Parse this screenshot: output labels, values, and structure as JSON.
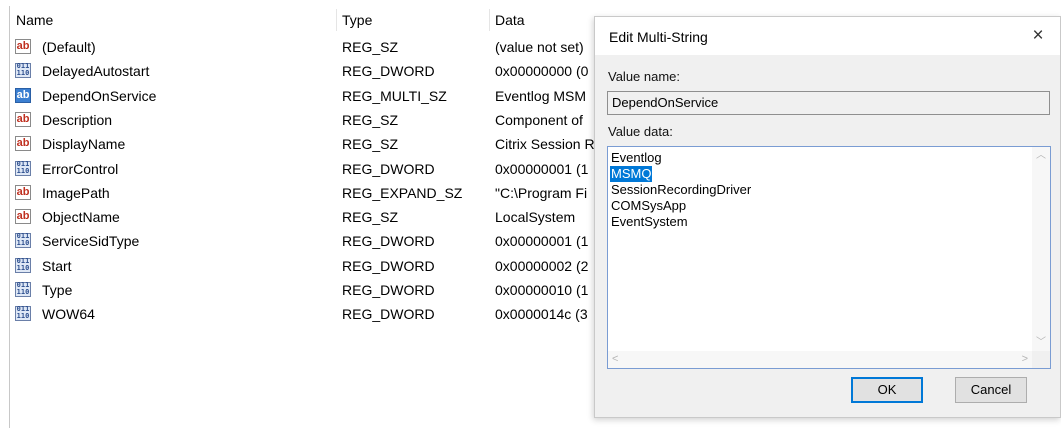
{
  "columns": {
    "name": "Name",
    "type": "Type",
    "data": "Data"
  },
  "rows": [
    {
      "icon": "string-value-icon",
      "name": "(Default)",
      "type": "REG_SZ",
      "data": "(value not set)"
    },
    {
      "icon": "binary-value-icon",
      "name": "DelayedAutostart",
      "type": "REG_DWORD",
      "data": "0x00000000 (0"
    },
    {
      "icon": "string-value-icon",
      "name": "DependOnService",
      "type": "REG_MULTI_SZ",
      "data": "Eventlog MSM"
    },
    {
      "icon": "string-value-icon",
      "name": "Description",
      "type": "REG_SZ",
      "data": "Component of"
    },
    {
      "icon": "string-value-icon",
      "name": "DisplayName",
      "type": "REG_SZ",
      "data": "Citrix Session R"
    },
    {
      "icon": "binary-value-icon",
      "name": "ErrorControl",
      "type": "REG_DWORD",
      "data": "0x00000001 (1"
    },
    {
      "icon": "string-value-icon",
      "name": "ImagePath",
      "type": "REG_EXPAND_SZ",
      "data": "\"C:\\Program Fi"
    },
    {
      "icon": "string-value-icon",
      "name": "ObjectName",
      "type": "REG_SZ",
      "data": "LocalSystem"
    },
    {
      "icon": "binary-value-icon",
      "name": "ServiceSidType",
      "type": "REG_DWORD",
      "data": "0x00000001 (1"
    },
    {
      "icon": "binary-value-icon",
      "name": "Start",
      "type": "REG_DWORD",
      "data": "0x00000002 (2"
    },
    {
      "icon": "binary-value-icon",
      "name": "Type",
      "type": "REG_DWORD",
      "data": "0x00000010 (1"
    },
    {
      "icon": "binary-value-icon",
      "name": "WOW64",
      "type": "REG_DWORD",
      "data": "0x0000014c (3"
    }
  ],
  "icons": {
    "string_glyph": "ab",
    "binary_glyph": "011 110"
  },
  "dialog": {
    "title": "Edit Multi-String",
    "close_glyph": "×",
    "value_name_label": "Value name:",
    "value_name": "DependOnService",
    "value_data_label": "Value data:",
    "value_data_lines": [
      "Eventlog",
      "MSMQ",
      "SessionRecordingDriver",
      "COMSysApp",
      "EventSystem"
    ],
    "selected_line": "MSMQ",
    "ok_label": "OK",
    "cancel_label": "Cancel"
  },
  "colors": {
    "selection": "#0078d7",
    "string_icon_red": "#c03020",
    "dword_icon_blue": "#2d4f8f"
  }
}
